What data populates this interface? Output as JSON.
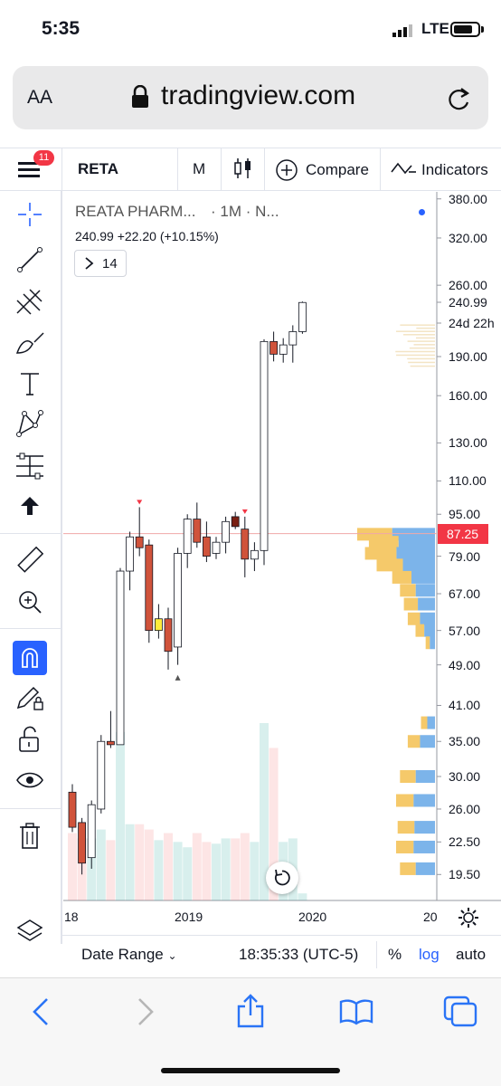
{
  "status_bar": {
    "time": "5:35",
    "carrier": "LTE"
  },
  "browser": {
    "text_size_label": "AA",
    "url": "tradingview.com"
  },
  "toolbar": {
    "menu_badge": "11",
    "symbol": "RETA",
    "interval": "M",
    "compare_label": "Compare",
    "indicators_label": "Indicators"
  },
  "legend": {
    "symbol_name": "REATA PHARM...",
    "timeframe": "· 1M · N...",
    "price": "240.99",
    "change": "+22.20 (+10.15%)",
    "collapse_count": "14"
  },
  "price_axis": {
    "labels": [
      "380.00",
      "320.00",
      "260.00",
      "240.99",
      "24d 22h",
      "190.00",
      "160.00",
      "130.00",
      "110.00",
      "95.00",
      "87.25",
      "79.00",
      "67.00",
      "57.00",
      "49.00",
      "41.00",
      "35.00",
      "30.00",
      "26.00",
      "22.50",
      "19.50"
    ],
    "current_price": "87.25"
  },
  "time_axis": {
    "labels": [
      "18",
      "2019",
      "2020",
      "20"
    ]
  },
  "bottom_bar": {
    "date_range": "Date Range",
    "clock": "18:35:33 (UTC-5)",
    "percent": "%",
    "log": "log",
    "auto": "auto"
  },
  "colors": {
    "up": "#ffffff",
    "down": "#d0533b",
    "accent": "#2962ff",
    "price_tag": "#f23645"
  },
  "chart_data": {
    "type": "candlestick",
    "interval": "1M",
    "candles": [
      {
        "o": 28,
        "h": 29,
        "l": 23.5,
        "c": 24
      },
      {
        "o": 24.5,
        "h": 25,
        "l": 19.5,
        "c": 20.5
      },
      {
        "o": 21,
        "h": 27,
        "l": 20,
        "c": 26.5
      },
      {
        "o": 26,
        "h": 36,
        "l": 25.5,
        "c": 35
      },
      {
        "o": 35,
        "h": 40,
        "l": 34,
        "c": 34.5
      },
      {
        "o": 34.5,
        "h": 75,
        "l": 34.5,
        "c": 74
      },
      {
        "o": 74,
        "h": 88,
        "l": 68,
        "c": 86
      },
      {
        "o": 86,
        "h": 98,
        "l": 79,
        "c": 82
      },
      {
        "o": 83,
        "h": 85,
        "l": 54,
        "c": 57
      },
      {
        "o": 57,
        "h": 64,
        "l": 55,
        "c": 60
      },
      {
        "o": 60,
        "h": 63,
        "l": 48,
        "c": 52
      },
      {
        "o": 53,
        "h": 82,
        "l": 49,
        "c": 80
      },
      {
        "o": 80,
        "h": 95,
        "l": 75,
        "c": 93
      },
      {
        "o": 93,
        "h": 100,
        "l": 82,
        "c": 84
      },
      {
        "o": 86,
        "h": 92,
        "l": 77,
        "c": 79
      },
      {
        "o": 80,
        "h": 86,
        "l": 78,
        "c": 84
      },
      {
        "o": 84,
        "h": 94,
        "l": 80,
        "c": 92
      },
      {
        "o": 94,
        "h": 96,
        "l": 89,
        "c": 90
      },
      {
        "o": 89,
        "h": 94,
        "l": 72,
        "c": 78
      },
      {
        "o": 78,
        "h": 84,
        "l": 74,
        "c": 81
      },
      {
        "o": 81,
        "h": 205,
        "l": 76,
        "c": 203
      },
      {
        "o": 203,
        "h": 212,
        "l": 186,
        "c": 192
      },
      {
        "o": 192,
        "h": 206,
        "l": 185,
        "c": 200
      },
      {
        "o": 200,
        "h": 218,
        "l": 185,
        "c": 212
      },
      {
        "o": 212,
        "h": 242,
        "l": 210,
        "c": 240.99
      }
    ],
    "volume_relative": [
      0.38,
      0.35,
      0.35,
      0.4,
      0.34,
      0.95,
      0.43,
      0.43,
      0.4,
      0.34,
      0.38,
      0.33,
      0.3,
      0.38,
      0.33,
      0.32,
      0.35,
      0.35,
      0.38,
      0.33,
      1.0,
      0.86,
      0.33,
      0.35,
      0.04
    ],
    "yscale": "log",
    "ylim": [
      18,
      420
    ],
    "volume_profile": [
      {
        "price": 87,
        "value": 1.0
      },
      {
        "price": 84,
        "value": 0.85
      },
      {
        "price": 80,
        "value": 0.9
      },
      {
        "price": 76,
        "value": 0.75
      },
      {
        "price": 72,
        "value": 0.55
      },
      {
        "price": 68,
        "value": 0.45
      },
      {
        "price": 64,
        "value": 0.4
      },
      {
        "price": 60,
        "value": 0.35
      },
      {
        "price": 57,
        "value": 0.25
      },
      {
        "price": 54,
        "value": 0.12
      },
      {
        "price": 38,
        "value": 0.18
      },
      {
        "price": 35,
        "value": 0.35
      },
      {
        "price": 30,
        "value": 0.45
      },
      {
        "price": 27,
        "value": 0.5
      },
      {
        "price": 24,
        "value": 0.48
      },
      {
        "price": 22,
        "value": 0.5
      },
      {
        "price": 20,
        "value": 0.45
      }
    ]
  }
}
